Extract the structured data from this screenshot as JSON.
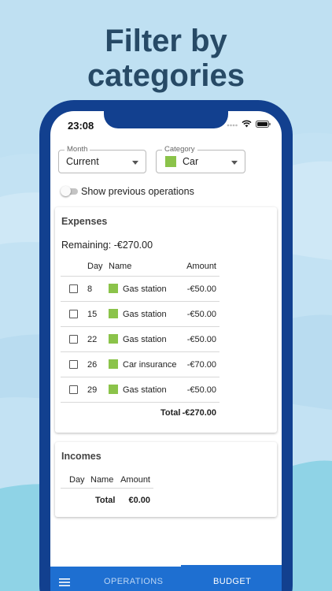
{
  "headline": {
    "line1": "Filter by",
    "line2": "categories"
  },
  "status_bar": {
    "time": "23:08"
  },
  "filters": {
    "month": {
      "label": "Month",
      "value": "Current"
    },
    "category": {
      "label": "Category",
      "value": "Car",
      "color": "#8bc34a"
    }
  },
  "show_previous": {
    "label": "Show previous operations",
    "enabled": false
  },
  "expenses": {
    "title": "Expenses",
    "remaining": "Remaining: -€270.00",
    "columns": {
      "day": "Day",
      "name": "Name",
      "amount": "Amount"
    },
    "rows": [
      {
        "day": "8",
        "name": "Gas station",
        "amount": "-€50.00"
      },
      {
        "day": "15",
        "name": "Gas station",
        "amount": "-€50.00"
      },
      {
        "day": "22",
        "name": "Gas station",
        "amount": "-€50.00"
      },
      {
        "day": "26",
        "name": "Car insurance",
        "amount": "-€70.00"
      },
      {
        "day": "29",
        "name": "Gas station",
        "amount": "-€50.00"
      }
    ],
    "total_label": "Total",
    "total_value": "-€270.00"
  },
  "incomes": {
    "title": "Incomes",
    "columns": {
      "day": "Day",
      "name": "Name",
      "amount": "Amount"
    },
    "total_label": "Total",
    "total_value": "€0.00"
  },
  "bottom_nav": {
    "items": [
      {
        "label": "OPERATIONS",
        "active": false
      },
      {
        "label": "BUDGET",
        "active": true
      }
    ]
  },
  "colors": {
    "background": "#c3e2f3",
    "headline": "#274a66",
    "phone_frame": "#12408f",
    "nav_bar": "#1e6fd1",
    "category_swatch": "#8bc34a"
  }
}
